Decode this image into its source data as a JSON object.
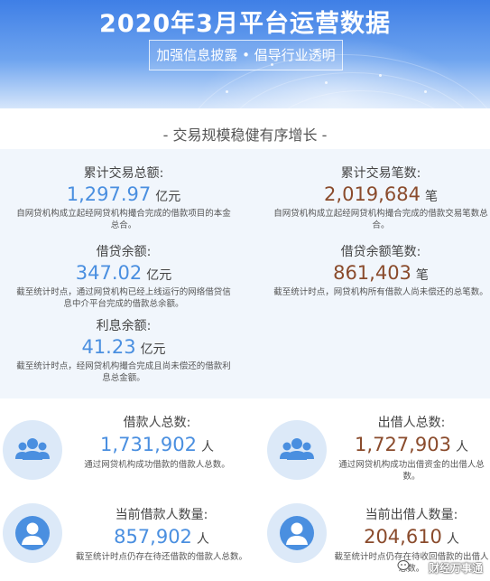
{
  "banner": {
    "title": "2020年3月平台运营数据",
    "subtitle": "加强信息披露 • 倡导行业透明"
  },
  "section": {
    "heading": "- 交易规模稳健有序增长 -"
  },
  "stats": {
    "total_volume": {
      "label": "累计交易总额:",
      "value": "1,297.97",
      "unit": "亿元",
      "desc": "自网贷机构成立起经网贷机构撮合完成的借款项目的本金总合。"
    },
    "total_count": {
      "label": "累计交易笔数:",
      "value": "2,019,684",
      "unit": "笔",
      "desc": "自网贷机构成立起经网贷机构撮合完成的借款交易笔数总合。"
    },
    "loan_balance": {
      "label": "借贷余额:",
      "value": "347.02",
      "unit": "亿元",
      "desc": "截至统计时点，通过网贷机构已经上线运行的网络借贷信息中介平台完成的借款总余额。"
    },
    "loan_balance_count": {
      "label": "借贷余额笔数:",
      "value": "861,403",
      "unit": "笔",
      "desc": "截至统计时点，网贷机构所有借款人尚未偿还的总笔数。"
    },
    "interest_balance": {
      "label": "利息余额:",
      "value": "41.23",
      "unit": "亿元",
      "desc": "截至统计时点，经网贷机构撮合完成且尚未偿还的借款利息总金额。"
    }
  },
  "people": {
    "borrowers_total": {
      "label": "借款人总数:",
      "value": "1,731,902",
      "unit": "人",
      "desc": "通过网贷机构成功借款的借款人总数。"
    },
    "lenders_total": {
      "label": "出借人总数:",
      "value": "1,727,903",
      "unit": "人",
      "desc": "通过网贷机构成功出借资金的出借人总数。"
    },
    "borrowers_current": {
      "label": "当前借款人数量:",
      "value": "857,902",
      "unit": "人",
      "desc": "截至统计时点仍存在待还借款的借款人总数。"
    },
    "lenders_current": {
      "label": "当前出借人数量:",
      "value": "204,610",
      "unit": "人",
      "desc": "截至统计时点仍存在待收回借款的出借人总数。"
    }
  },
  "watermark": {
    "text": "财经万事通"
  },
  "colors": {
    "banner_top": "#3f7fe6",
    "accent_blue": "#4a8fe0",
    "accent_brown": "#8a4b2c",
    "panel_bg": "#f1f6fc",
    "icon_circle": "#dce9f8"
  },
  "icons": {
    "group": "user-group-icon",
    "single": "user-icon"
  }
}
